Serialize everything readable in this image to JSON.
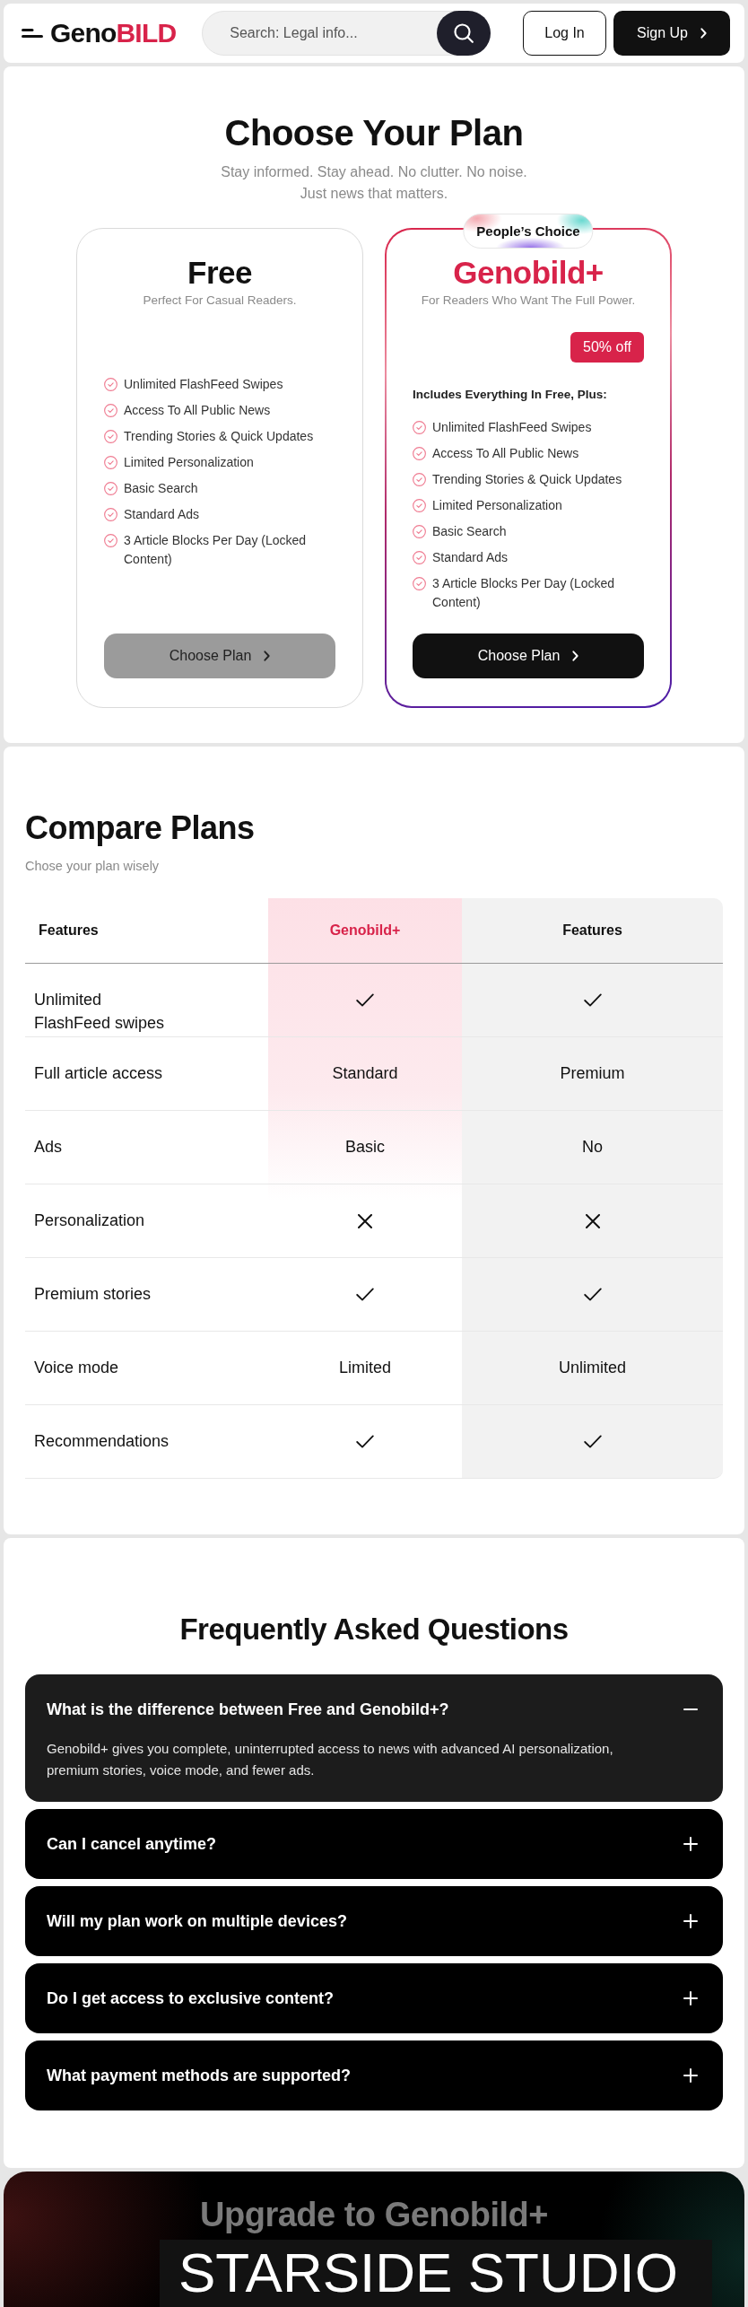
{
  "header": {
    "logo": {
      "prefix": "Geno",
      "highlight": "BILD"
    },
    "search": {
      "placeholder": "Search: Legal info..."
    },
    "buttons": [
      {
        "label": "Log In",
        "kind": "outline"
      },
      {
        "label": "Sign Up",
        "kind": "primary"
      }
    ]
  },
  "pricing": {
    "title": "Choose Your Plan",
    "subtitle": "Stay informed. Stay ahead. No clutter. No noise. Just news that matters.",
    "plans": [
      {
        "name": "Free",
        "tagline": "Perfect For Casual Readers.",
        "featured": false,
        "features": [
          "Unlimited FlashFeed Swipes",
          "Access To All Public News",
          "Trending Stories & Quick Updates",
          "Limited Personalization",
          "Basic Search",
          "Standard Ads",
          "3 Article Blocks Per Day (Locked Content)"
        ],
        "button": "Choose Plan"
      },
      {
        "name": "Genobild+",
        "tagline": "For Readers Who Want The Full Power.",
        "featured": true,
        "ribbon": "People’s Choice",
        "discount": "50% off",
        "includes": "Includes Everything In Free, Plus:",
        "features": [
          "Unlimited FlashFeed Swipes",
          "Access To All Public News",
          "Trending Stories & Quick Updates",
          "Limited Personalization",
          "Basic Search",
          "Standard Ads",
          "3 Article Blocks Per Day (Locked Content)"
        ],
        "button": "Choose Plan"
      }
    ]
  },
  "compare": {
    "title": "Compare Plans",
    "subtitle": "Chose your plan wisely",
    "columns": [
      {
        "label": "Features",
        "kind": "feature"
      },
      {
        "label": "Genobild+",
        "kind": "featured"
      },
      {
        "label": "Features",
        "kind": "plan"
      }
    ],
    "rows": [
      {
        "feature": "Unlimited FlashFeed swipes",
        "values": [
          {
            "kind": "check"
          },
          {
            "kind": "check"
          }
        ]
      },
      {
        "feature": "Full article access",
        "values": [
          {
            "kind": "text",
            "text": "Standard"
          },
          {
            "kind": "text",
            "text": "Premium"
          }
        ]
      },
      {
        "feature": "Ads",
        "values": [
          {
            "kind": "text",
            "text": "Basic"
          },
          {
            "kind": "text",
            "text": "No"
          }
        ]
      },
      {
        "feature": "Personalization",
        "values": [
          {
            "kind": "cross"
          },
          {
            "kind": "cross"
          }
        ]
      },
      {
        "feature": "Premium stories",
        "values": [
          {
            "kind": "check"
          },
          {
            "kind": "check"
          }
        ]
      },
      {
        "feature": "Voice mode",
        "values": [
          {
            "kind": "text",
            "text": "Limited"
          },
          {
            "kind": "text",
            "text": "Unlimited"
          }
        ]
      },
      {
        "feature": "Recommendations",
        "values": [
          {
            "kind": "check"
          },
          {
            "kind": "check"
          }
        ]
      }
    ]
  },
  "faq": {
    "title": "Frequently Asked Questions",
    "items": [
      {
        "question": "What is the difference between Free and Genobild+?",
        "answer": "Genobild+ gives you complete, uninterrupted access to news with advanced AI personalization, premium stories, voice mode, and fewer ads.",
        "expanded": true
      },
      {
        "question": "Can I cancel anytime?",
        "expanded": false
      },
      {
        "question": "Will my plan work on multiple devices?",
        "expanded": false
      },
      {
        "question": "Do I get access to exclusive content?",
        "expanded": false
      },
      {
        "question": "What payment methods are supported?",
        "expanded": false
      }
    ]
  },
  "upgrade": {
    "title": "Upgrade to Genobild+",
    "banner": "STARSIDE STUDIO"
  }
}
